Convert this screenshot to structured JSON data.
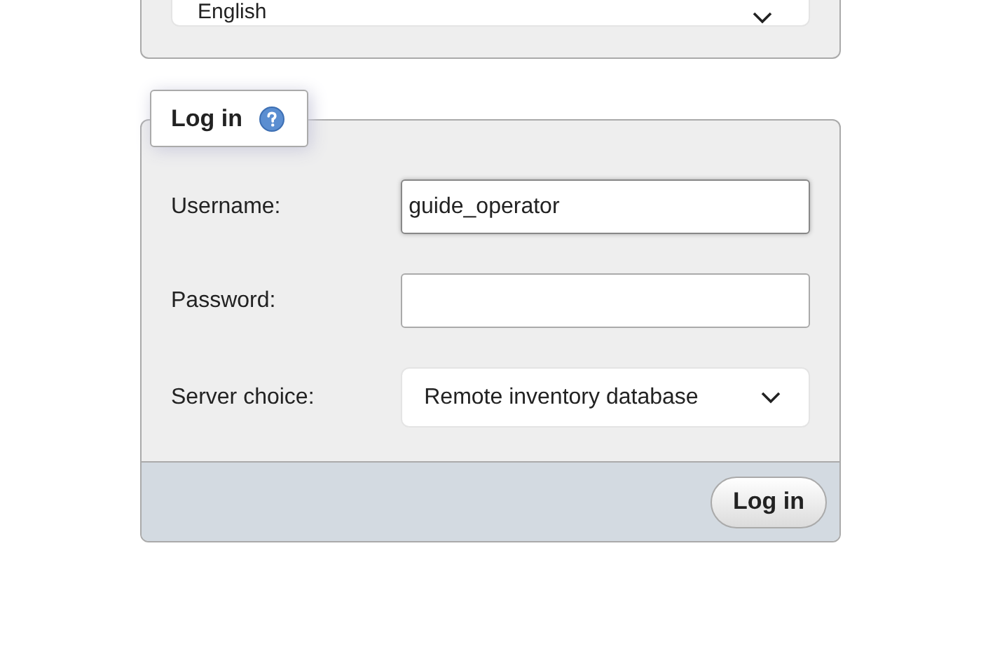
{
  "language_panel": {
    "select": {
      "value": "English"
    }
  },
  "login": {
    "title": "Log in",
    "fields": [
      {
        "kind": "text",
        "label": "Username:",
        "value": "guide_operator"
      },
      {
        "kind": "password",
        "label": "Password:"
      },
      {
        "kind": "select",
        "label": "Server choice:",
        "value": "Remote inventory database"
      }
    ],
    "submit": "Log in"
  }
}
